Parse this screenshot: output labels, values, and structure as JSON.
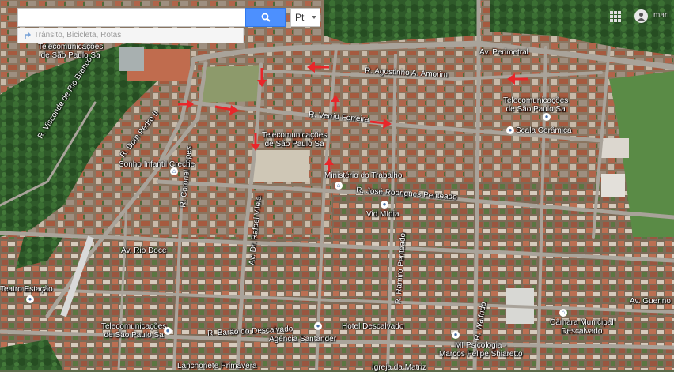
{
  "search": {
    "value": "",
    "placeholder": "",
    "button_icon": "search-icon"
  },
  "directions": {
    "icon": "directions-icon",
    "text": "Trânsito, Bicicleta, Rotas"
  },
  "language": {
    "value": "Pt"
  },
  "account": {
    "label": "mari"
  },
  "colors": {
    "search_button": "#4d90fe",
    "arrow": "#e8262a",
    "label": "#ffffff",
    "road": "#a9a39a",
    "field": "#3f7a3a"
  },
  "streets": {
    "perimetral": "Av. Perimetral",
    "agostinho": "R. Agostinho A. Amorim",
    "verrid": "R. Verrid Ferreira",
    "dom_pedro": "R. Dom Pedro II",
    "jose_rodrigues": "R. José Rodrigues Penteado",
    "rio_doce": "Av. Rio Doce",
    "barao": "R. Barão do Descalvado",
    "coronel": "R. Coronel Lopes",
    "dr_rafael": "Av. Dr. Rafael Vilela",
    "ramiro": "R. Ramiro Penteado",
    "guerino": "Av. Guerino",
    "visconde": "R. Visconde de Rio Branco",
    "walfrido": "R. Walfrido"
  },
  "pois": {
    "telecom_nw": "Telecomunicações\nde São Paulo Sa",
    "telecom_center": "Telecomunicações\nde São Paulo Sa",
    "telecom_ne": "Telecomunicações\nde São Paulo Sa",
    "telecom_sw": "Telecomunicações\nde São Paulo Sa",
    "scala": "Scala Cerâmica",
    "sonho": "Sonho Infantil Creche",
    "ministerio": "Ministério do Trabalho",
    "vid": "Vid Mídia",
    "teatro": "Teatro Estação",
    "hotel": "Hotel Descalvado",
    "agencia": "Agência Santander",
    "camara": "Câmara Municipal\nDescalvado",
    "mi_psicologia": "MI Psicologia -\nMarcos Felipe Shiaretto",
    "lanchonete": "Lanchonete Primavera",
    "igreja": "Igreja da Matriz"
  },
  "arrows": [
    {
      "name": "arrow-1",
      "dir": "left"
    },
    {
      "name": "arrow-2",
      "dir": "down"
    },
    {
      "name": "arrow-3",
      "dir": "left"
    },
    {
      "name": "arrow-4",
      "dir": "right"
    },
    {
      "name": "arrow-5",
      "dir": "right"
    },
    {
      "name": "arrow-6",
      "dir": "up"
    },
    {
      "name": "arrow-7",
      "dir": "right"
    },
    {
      "name": "arrow-8",
      "dir": "down"
    },
    {
      "name": "arrow-9",
      "dir": "up"
    },
    {
      "name": "arrow-10",
      "dir": "left"
    }
  ]
}
